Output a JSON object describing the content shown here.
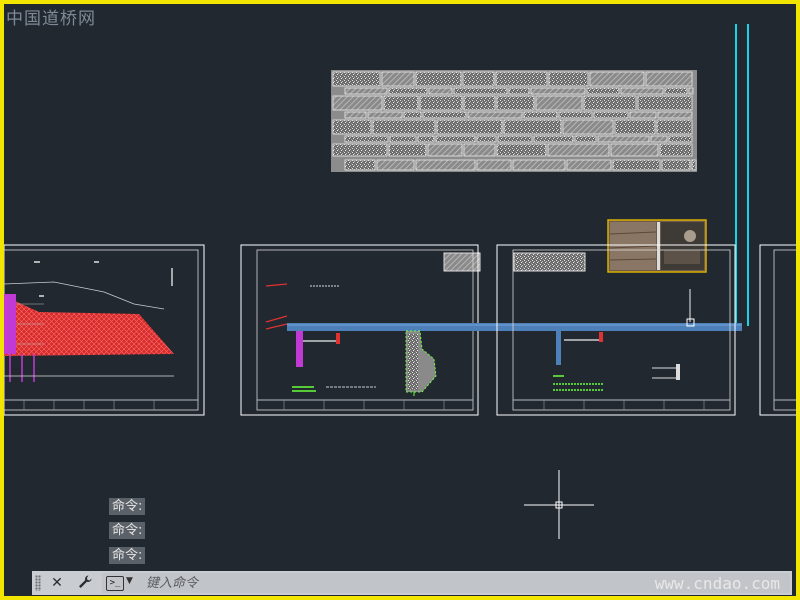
{
  "watermark_top": "中国道桥网",
  "watermark_bottom": "www.cndao.com",
  "command_history": [
    "命令:",
    "命令:",
    "命令:"
  ],
  "command_line": {
    "placeholder": "键入命令",
    "close_icon": "close-icon",
    "customize_icon": "wrench-icon",
    "prompt_icon": "command-prompt-icon"
  },
  "colors": {
    "model_space": "#212830",
    "window_border": "#f2e600",
    "cyan_line": "#19d4e6",
    "sheet_frame": "#ffffff"
  }
}
